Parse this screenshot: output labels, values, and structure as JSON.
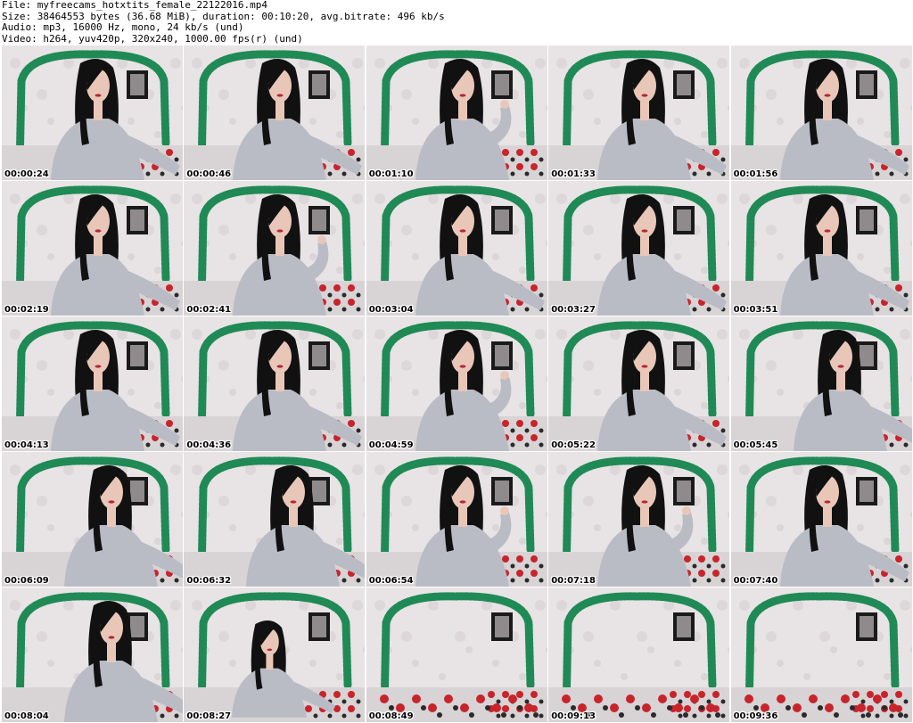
{
  "header": {
    "file": "File: myfreecams_hotxtits_female_22122016.mp4",
    "size": "Size: 38464553 bytes (36.68 MiB), duration: 00:10:20, avg.bitrate: 496 kb/s",
    "audio": "Audio: mp3, 16000 Hz, mono, 24 kb/s (und)",
    "video": "Video: h264, yuv420p, 320x240, 1000.00 fps(r) (und)"
  },
  "grid": {
    "columns": 5,
    "rows": 5
  },
  "thumbnails": [
    {
      "timestamp": "00:00:24",
      "variant": "a"
    },
    {
      "timestamp": "00:00:46",
      "variant": "a"
    },
    {
      "timestamp": "00:01:10",
      "variant": "b"
    },
    {
      "timestamp": "00:01:33",
      "variant": "a"
    },
    {
      "timestamp": "00:01:56",
      "variant": "a"
    },
    {
      "timestamp": "00:02:19",
      "variant": "a"
    },
    {
      "timestamp": "00:02:41",
      "variant": "b"
    },
    {
      "timestamp": "00:03:04",
      "variant": "a"
    },
    {
      "timestamp": "00:03:27",
      "variant": "a"
    },
    {
      "timestamp": "00:03:51",
      "variant": "a"
    },
    {
      "timestamp": "00:04:13",
      "variant": "a"
    },
    {
      "timestamp": "00:04:36",
      "variant": "a"
    },
    {
      "timestamp": "00:04:59",
      "variant": "b"
    },
    {
      "timestamp": "00:05:22",
      "variant": "a"
    },
    {
      "timestamp": "00:05:45",
      "variant": "c"
    },
    {
      "timestamp": "00:06:09",
      "variant": "c"
    },
    {
      "timestamp": "00:06:32",
      "variant": "c"
    },
    {
      "timestamp": "00:06:54",
      "variant": "b"
    },
    {
      "timestamp": "00:07:18",
      "variant": "b"
    },
    {
      "timestamp": "00:07:40",
      "variant": "a"
    },
    {
      "timestamp": "00:08:04",
      "variant": "c"
    },
    {
      "timestamp": "00:08:27",
      "variant": "d"
    },
    {
      "timestamp": "00:08:49",
      "variant": "e"
    },
    {
      "timestamp": "00:09:13",
      "variant": "e"
    },
    {
      "timestamp": "00:09:36",
      "variant": "e"
    }
  ],
  "colors": {
    "wallpaper": "#e8e3e5",
    "garland": "#1f8a55",
    "sweater": "#b9bcc4",
    "hair": "#111111",
    "skin": "#e9c7b8",
    "couch": "#d8d4d6",
    "flowers": "#c8242c",
    "frame": "#1a1a1a"
  }
}
